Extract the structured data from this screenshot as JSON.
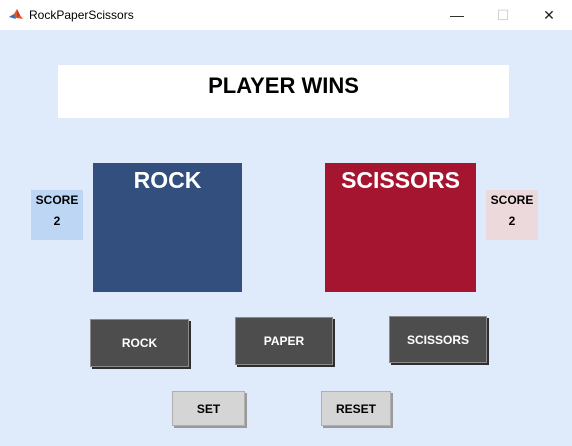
{
  "window": {
    "title": "RockPaperScissors",
    "minimize_icon": "—",
    "maximize_icon": "☐",
    "close_icon": "✕"
  },
  "game": {
    "result_text": "PLAYER WINS",
    "player_choice": "ROCK",
    "computer_choice": "SCISSORS",
    "player_score_label": "SCORE",
    "player_score": "2",
    "computer_score_label": "SCORE",
    "computer_score": "2"
  },
  "buttons": {
    "rock": "ROCK",
    "paper": "PAPER",
    "scissors": "SCISSORS",
    "set": "SET",
    "reset": "RESET"
  },
  "colors": {
    "background": "#dfeafa",
    "player_panel": "#334f7e",
    "computer_panel": "#a51530",
    "player_score_bg": "#bcd6f4",
    "computer_score_bg": "#ecd9dc",
    "choice_button_bg": "#4d4d4d",
    "control_button_bg": "#d5d5d5"
  }
}
